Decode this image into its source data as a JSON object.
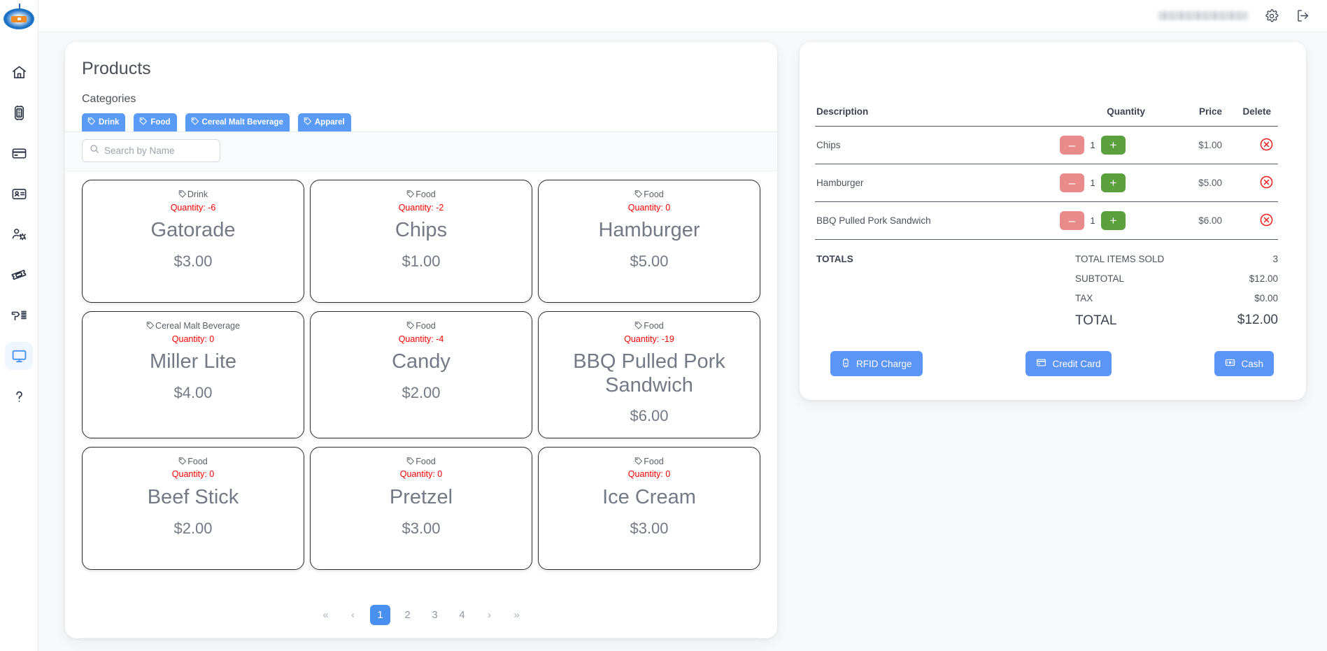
{
  "sidebar": {
    "logo_name": "brandy-logo",
    "items": [
      {
        "name": "home",
        "icon": "home-icon",
        "active": false
      },
      {
        "name": "terminal",
        "icon": "pos-terminal-icon",
        "active": false
      },
      {
        "name": "payments",
        "icon": "credit-card-icon",
        "active": false
      },
      {
        "name": "members",
        "icon": "id-card-icon",
        "active": false
      },
      {
        "name": "staff",
        "icon": "users-gear-icon",
        "active": false
      },
      {
        "name": "tickets",
        "icon": "ticket-icon",
        "active": false
      },
      {
        "name": "scanner",
        "icon": "barcode-scanner-icon",
        "active": false
      },
      {
        "name": "register",
        "icon": "monitor-icon",
        "active": true
      },
      {
        "name": "help",
        "icon": "question-mark-icon",
        "active": false
      }
    ]
  },
  "topbar": {
    "user_email": "",
    "settings_icon": "gear-icon",
    "logout_icon": "logout-icon"
  },
  "products": {
    "title": "Products",
    "categories_label": "Categories",
    "category_pills": [
      {
        "label": "Drink"
      },
      {
        "label": "Food"
      },
      {
        "label": "Cereal Malt Beverage"
      },
      {
        "label": "Apparel"
      }
    ],
    "search": {
      "placeholder": "Search by Name",
      "value": "",
      "icon": "search-icon"
    },
    "qty_prefix": "Quantity: ",
    "items": [
      {
        "category": "Drink",
        "quantity": "Quantity: -6",
        "name": "Gatorade",
        "price": "$3.00"
      },
      {
        "category": "Food",
        "quantity": "Quantity: -2",
        "name": "Chips",
        "price": "$1.00"
      },
      {
        "category": "Food",
        "quantity": "Quantity: 0",
        "name": "Hamburger",
        "price": "$5.00"
      },
      {
        "category": "Cereal Malt Beverage",
        "quantity": "Quantity: 0",
        "name": "Miller Lite",
        "price": "$4.00"
      },
      {
        "category": "Food",
        "quantity": "Quantity: -4",
        "name": "Candy",
        "price": "$2.00"
      },
      {
        "category": "Food",
        "quantity": "Quantity: -19",
        "name": "BBQ Pulled Pork Sandwich",
        "price": "$6.00"
      },
      {
        "category": "Food",
        "quantity": "Quantity: 0",
        "name": "Beef Stick",
        "price": "$2.00"
      },
      {
        "category": "Food",
        "quantity": "Quantity: 0",
        "name": "Pretzel",
        "price": "$3.00"
      },
      {
        "category": "Food",
        "quantity": "Quantity: 0",
        "name": "Ice Cream",
        "price": "$3.00"
      }
    ],
    "pagination": {
      "first": "«",
      "prev": "‹",
      "pages": [
        "1",
        "2",
        "3",
        "4"
      ],
      "active_page": "1",
      "next": "›",
      "last": "»"
    }
  },
  "order": {
    "columns": {
      "description": "Description",
      "quantity": "Quantity",
      "price": "Price",
      "delete": "Delete"
    },
    "rows": [
      {
        "description": "Chips",
        "quantity": "1",
        "price": "$1.00",
        "minus": "–",
        "plus": "+"
      },
      {
        "description": "Hamburger",
        "quantity": "1",
        "price": "$5.00",
        "minus": "–",
        "plus": "+"
      },
      {
        "description": "BBQ Pulled Pork Sandwich",
        "quantity": "1",
        "price": "$6.00",
        "minus": "–",
        "plus": "+"
      }
    ],
    "totals": {
      "label": "TOTALS",
      "items_sold_label": "TOTAL ITEMS SOLD",
      "items_sold_value": "3",
      "subtotal_label": "SUBTOTAL",
      "subtotal_value": "$12.00",
      "tax_label": "TAX",
      "tax_value": "$0.00",
      "total_label": "TOTAL",
      "total_value": "$12.00"
    },
    "payment_buttons": [
      {
        "label": "RFID Charge",
        "icon": "watch-icon"
      },
      {
        "label": "Credit Card",
        "icon": "credit-card-icon"
      },
      {
        "label": "Cash",
        "icon": "money-bill-icon"
      }
    ]
  },
  "colors": {
    "accent_blue": "#5b95f7",
    "pill_blue": "#5b9bf8",
    "quantity_red": "#ff0000",
    "minus_red": "#e98b8b",
    "plus_green": "#5aa03c",
    "delete_red": "#f21a1a",
    "page_bg": "#f7f8fa"
  }
}
